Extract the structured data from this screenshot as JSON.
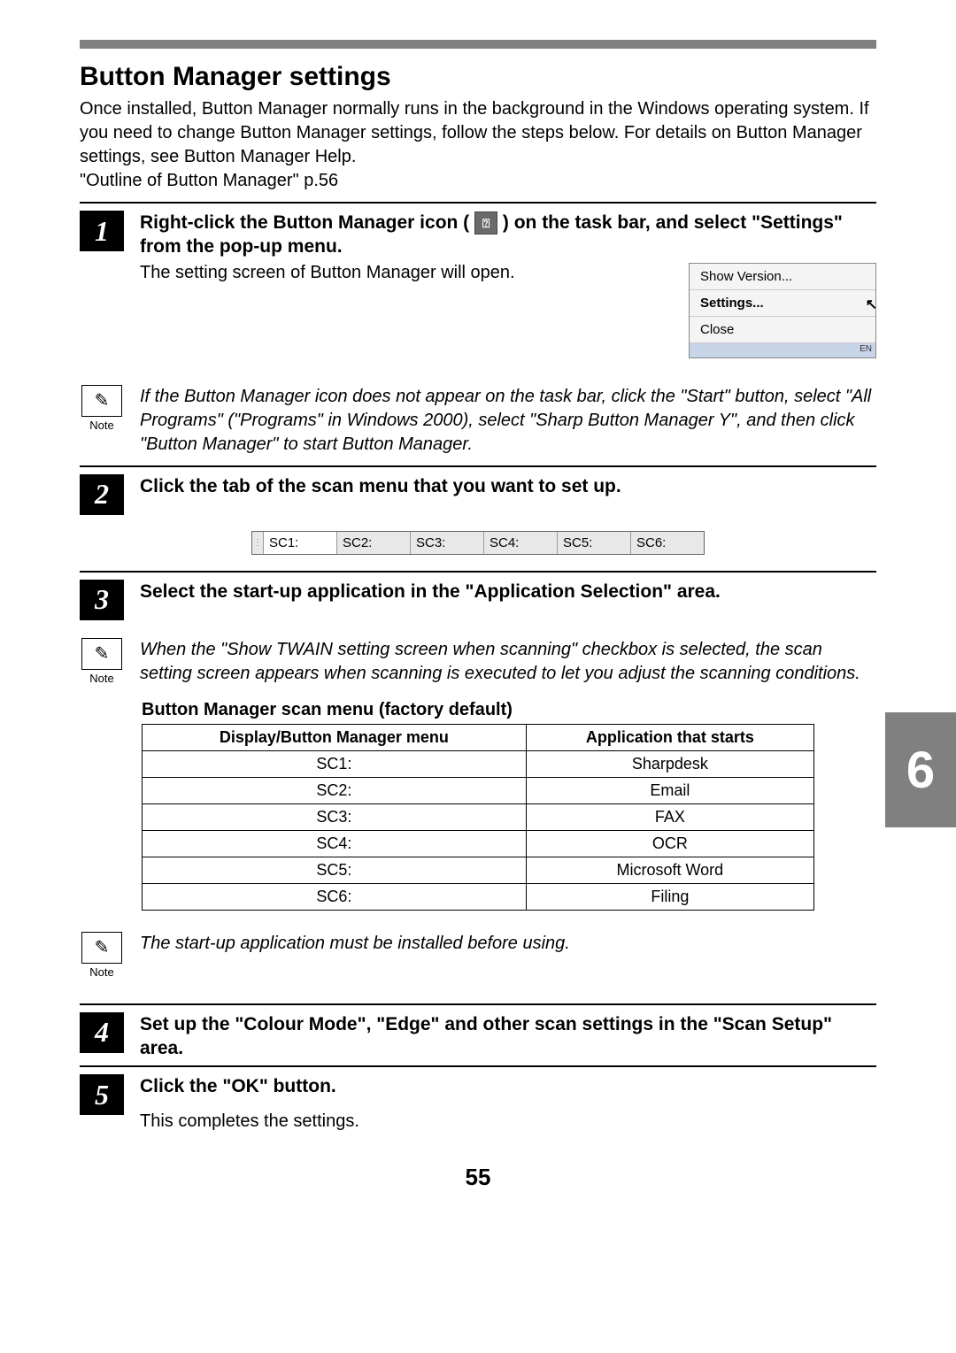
{
  "heading": "Button Manager settings",
  "intro": "Once installed, Button Manager normally runs in the background in the Windows operating system. If you need to change Button Manager settings, follow the steps below. For details on Button Manager settings, see Button Manager Help.",
  "intro_ref": "\"Outline of Button Manager\" p.56",
  "steps": {
    "s1": {
      "num": "1",
      "title_a": "Right-click the Button Manager icon (",
      "title_b": ") on the task bar, and select \"Settings\" from the pop-up menu.",
      "sub": "The setting screen of Button Manager will open."
    },
    "s2": {
      "num": "2",
      "title": "Click the tab of the scan menu that you want to set up."
    },
    "s3": {
      "num": "3",
      "title": "Select the start-up application in the \"Application Selection\" area."
    },
    "s4": {
      "num": "4",
      "title": "Set up the \"Colour Mode\", \"Edge\" and other scan settings in the \"Scan Setup\" area."
    },
    "s5": {
      "num": "5",
      "title": "Click the \"OK\" button.",
      "sub": "This completes the settings."
    }
  },
  "popup": {
    "show_version": "Show Version...",
    "settings": "Settings...",
    "close": "Close",
    "tray": "EN"
  },
  "notes": {
    "label": "Note",
    "n1": "If the Button Manager icon does not appear on the task bar, click the \"Start\" button, select \"All Programs\" (\"Programs\" in Windows 2000), select \"Sharp Button Manager Y\", and then click \"Button Manager\" to start Button Manager.",
    "n2": "When the \"Show TWAIN setting screen when scanning\" checkbox is selected, the scan setting screen appears when scanning is executed to let you adjust the scanning conditions.",
    "n3": "The start-up application must be installed before using."
  },
  "tabs": [
    "SC1:",
    "SC2:",
    "SC3:",
    "SC4:",
    "SC5:",
    "SC6:"
  ],
  "table": {
    "title": "Button Manager scan menu (factory default)",
    "head1": "Display/Button Manager menu",
    "head2": "Application that starts",
    "rows": [
      {
        "c1": "SC1:",
        "c2": "Sharpdesk"
      },
      {
        "c1": "SC2:",
        "c2": "Email"
      },
      {
        "c1": "SC3:",
        "c2": "FAX"
      },
      {
        "c1": "SC4:",
        "c2": "OCR"
      },
      {
        "c1": "SC5:",
        "c2": "Microsoft Word"
      },
      {
        "c1": "SC6:",
        "c2": "Filing"
      }
    ]
  },
  "chapter": "6",
  "page_number": "55"
}
